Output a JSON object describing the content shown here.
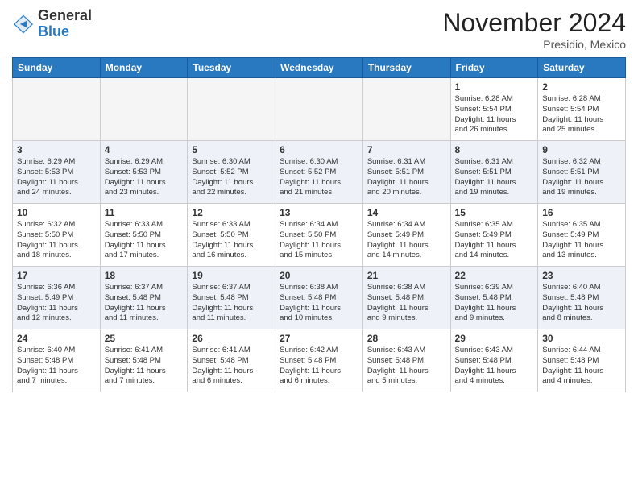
{
  "header": {
    "logo_general": "General",
    "logo_blue": "Blue",
    "month_title": "November 2024",
    "location": "Presidio, Mexico"
  },
  "weekdays": [
    "Sunday",
    "Monday",
    "Tuesday",
    "Wednesday",
    "Thursday",
    "Friday",
    "Saturday"
  ],
  "weeks": [
    [
      {
        "day": "",
        "info": ""
      },
      {
        "day": "",
        "info": ""
      },
      {
        "day": "",
        "info": ""
      },
      {
        "day": "",
        "info": ""
      },
      {
        "day": "",
        "info": ""
      },
      {
        "day": "1",
        "info": "Sunrise: 6:28 AM\nSunset: 5:54 PM\nDaylight: 11 hours\nand 26 minutes."
      },
      {
        "day": "2",
        "info": "Sunrise: 6:28 AM\nSunset: 5:54 PM\nDaylight: 11 hours\nand 25 minutes."
      }
    ],
    [
      {
        "day": "3",
        "info": "Sunrise: 6:29 AM\nSunset: 5:53 PM\nDaylight: 11 hours\nand 24 minutes."
      },
      {
        "day": "4",
        "info": "Sunrise: 6:29 AM\nSunset: 5:53 PM\nDaylight: 11 hours\nand 23 minutes."
      },
      {
        "day": "5",
        "info": "Sunrise: 6:30 AM\nSunset: 5:52 PM\nDaylight: 11 hours\nand 22 minutes."
      },
      {
        "day": "6",
        "info": "Sunrise: 6:30 AM\nSunset: 5:52 PM\nDaylight: 11 hours\nand 21 minutes."
      },
      {
        "day": "7",
        "info": "Sunrise: 6:31 AM\nSunset: 5:51 PM\nDaylight: 11 hours\nand 20 minutes."
      },
      {
        "day": "8",
        "info": "Sunrise: 6:31 AM\nSunset: 5:51 PM\nDaylight: 11 hours\nand 19 minutes."
      },
      {
        "day": "9",
        "info": "Sunrise: 6:32 AM\nSunset: 5:51 PM\nDaylight: 11 hours\nand 19 minutes."
      }
    ],
    [
      {
        "day": "10",
        "info": "Sunrise: 6:32 AM\nSunset: 5:50 PM\nDaylight: 11 hours\nand 18 minutes."
      },
      {
        "day": "11",
        "info": "Sunrise: 6:33 AM\nSunset: 5:50 PM\nDaylight: 11 hours\nand 17 minutes."
      },
      {
        "day": "12",
        "info": "Sunrise: 6:33 AM\nSunset: 5:50 PM\nDaylight: 11 hours\nand 16 minutes."
      },
      {
        "day": "13",
        "info": "Sunrise: 6:34 AM\nSunset: 5:50 PM\nDaylight: 11 hours\nand 15 minutes."
      },
      {
        "day": "14",
        "info": "Sunrise: 6:34 AM\nSunset: 5:49 PM\nDaylight: 11 hours\nand 14 minutes."
      },
      {
        "day": "15",
        "info": "Sunrise: 6:35 AM\nSunset: 5:49 PM\nDaylight: 11 hours\nand 14 minutes."
      },
      {
        "day": "16",
        "info": "Sunrise: 6:35 AM\nSunset: 5:49 PM\nDaylight: 11 hours\nand 13 minutes."
      }
    ],
    [
      {
        "day": "17",
        "info": "Sunrise: 6:36 AM\nSunset: 5:49 PM\nDaylight: 11 hours\nand 12 minutes."
      },
      {
        "day": "18",
        "info": "Sunrise: 6:37 AM\nSunset: 5:48 PM\nDaylight: 11 hours\nand 11 minutes."
      },
      {
        "day": "19",
        "info": "Sunrise: 6:37 AM\nSunset: 5:48 PM\nDaylight: 11 hours\nand 11 minutes."
      },
      {
        "day": "20",
        "info": "Sunrise: 6:38 AM\nSunset: 5:48 PM\nDaylight: 11 hours\nand 10 minutes."
      },
      {
        "day": "21",
        "info": "Sunrise: 6:38 AM\nSunset: 5:48 PM\nDaylight: 11 hours\nand 9 minutes."
      },
      {
        "day": "22",
        "info": "Sunrise: 6:39 AM\nSunset: 5:48 PM\nDaylight: 11 hours\nand 9 minutes."
      },
      {
        "day": "23",
        "info": "Sunrise: 6:40 AM\nSunset: 5:48 PM\nDaylight: 11 hours\nand 8 minutes."
      }
    ],
    [
      {
        "day": "24",
        "info": "Sunrise: 6:40 AM\nSunset: 5:48 PM\nDaylight: 11 hours\nand 7 minutes."
      },
      {
        "day": "25",
        "info": "Sunrise: 6:41 AM\nSunset: 5:48 PM\nDaylight: 11 hours\nand 7 minutes."
      },
      {
        "day": "26",
        "info": "Sunrise: 6:41 AM\nSunset: 5:48 PM\nDaylight: 11 hours\nand 6 minutes."
      },
      {
        "day": "27",
        "info": "Sunrise: 6:42 AM\nSunset: 5:48 PM\nDaylight: 11 hours\nand 6 minutes."
      },
      {
        "day": "28",
        "info": "Sunrise: 6:43 AM\nSunset: 5:48 PM\nDaylight: 11 hours\nand 5 minutes."
      },
      {
        "day": "29",
        "info": "Sunrise: 6:43 AM\nSunset: 5:48 PM\nDaylight: 11 hours\nand 4 minutes."
      },
      {
        "day": "30",
        "info": "Sunrise: 6:44 AM\nSunset: 5:48 PM\nDaylight: 11 hours\nand 4 minutes."
      }
    ]
  ]
}
